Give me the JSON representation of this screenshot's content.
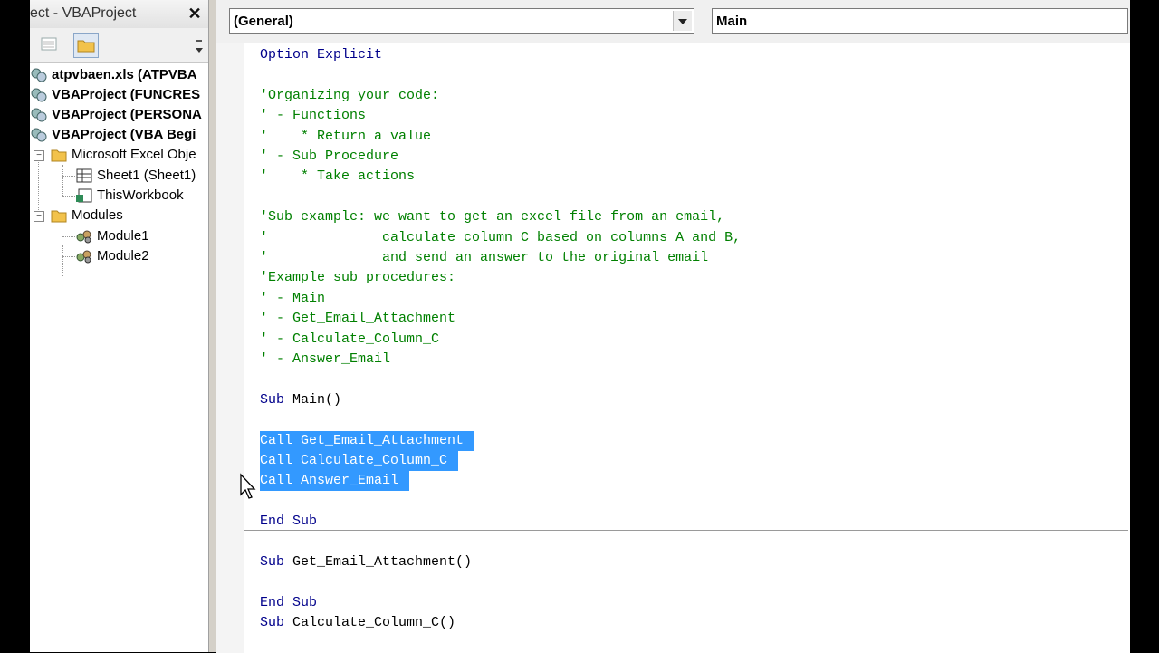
{
  "explorer": {
    "title": "ect - VBAProject",
    "close_label": "✕",
    "tree": [
      {
        "label": "atpvbaen.xls (ATPVBA",
        "bold": true,
        "icon": "vba-project-icon"
      },
      {
        "label": "VBAProject (FUNCRES",
        "bold": true,
        "icon": "vba-project-icon"
      },
      {
        "label": "VBAProject (PERSONA",
        "bold": true,
        "icon": "vba-project-icon"
      },
      {
        "label": "VBAProject (VBA Begi",
        "bold": true,
        "icon": "vba-project-icon"
      },
      {
        "label": "Microsoft Excel Obje",
        "bold": false,
        "icon": "folder-icon",
        "expander": "−"
      },
      {
        "label": "Sheet1 (Sheet1)",
        "bold": false,
        "icon": "worksheet-icon"
      },
      {
        "label": "ThisWorkbook",
        "bold": false,
        "icon": "workbook-icon"
      },
      {
        "label": "Modules",
        "bold": false,
        "icon": "folder-icon",
        "expander": "−"
      },
      {
        "label": "Module1",
        "bold": false,
        "icon": "module-icon"
      },
      {
        "label": "Module2",
        "bold": false,
        "icon": "module-icon"
      }
    ]
  },
  "code_window": {
    "object_combo": "(General)",
    "procedure_combo": "Main"
  },
  "code": {
    "lines": [
      "Option Explicit",
      "",
      "'Organizing your code:",
      "' - Functions",
      "'    * Return a value",
      "' - Sub Procedure",
      "'    * Take actions",
      "",
      "'Sub example: we want to get an excel file from an email,",
      "'              calculate column C based on columns A and B,",
      "'              and send an answer to the original email",
      "'Example sub procedures:",
      "' - Main",
      "' - Get_Email_Attachment",
      "' - Calculate_Column_C",
      "' - Answer_Email",
      "",
      "Sub Main()",
      "",
      "Call Get_Email_Attachment",
      "Call Calculate_Column_C",
      "Call Answer_Email",
      "",
      "End Sub",
      "",
      "Sub Get_Email_Attachment()",
      "",
      "End Sub",
      "Sub Calculate_Column_C()"
    ]
  },
  "colors": {
    "comment": "#008000",
    "keyword": "#00008b",
    "selection": "#3399ff"
  }
}
